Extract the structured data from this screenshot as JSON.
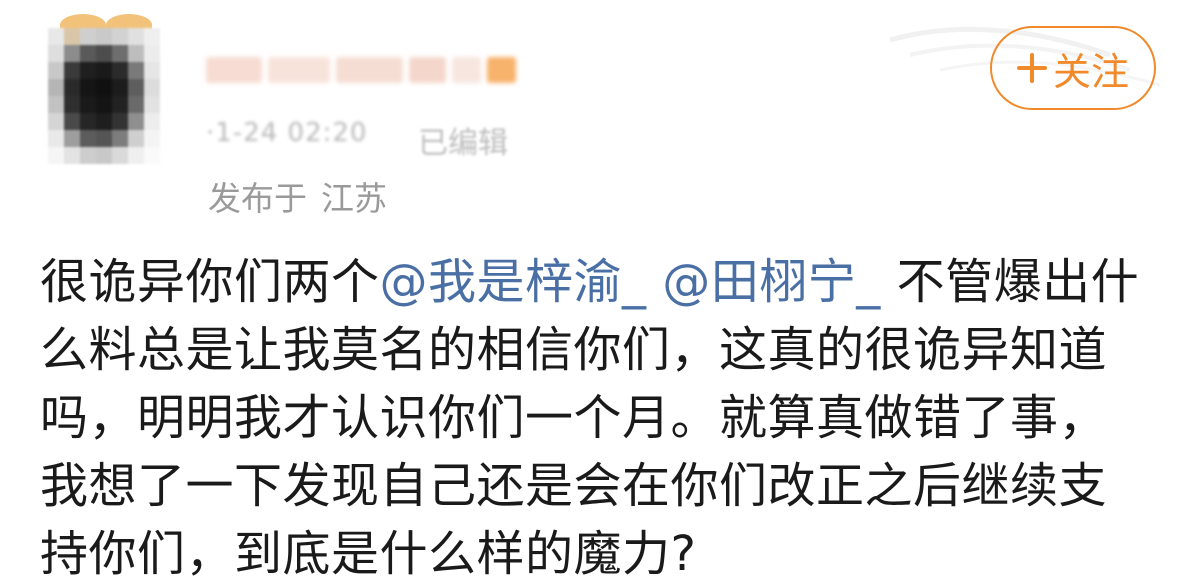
{
  "header": {
    "timestamp": "·1-24 02:20",
    "edited_label": "已编辑",
    "location_prefix": "发布于",
    "location_region": "江苏",
    "follow_button_label": "关注",
    "follow_icon": "plus-icon"
  },
  "post": {
    "line1_prefix": "很诡异你们两个",
    "mention1": "@我是梓渝_",
    "mention2": "@田栩宁_",
    "line1_suffix": "不管爆出什",
    "line2": "么料总是让我莫名的相信你们，这真的很诡异知道",
    "line3": "吗，明明我才认识你们一个月。就算真做错了事，",
    "line4": "我想了一下发现自己还是会在你们改正之后继续支",
    "line5": "持你们，到底是什么样的魔力?"
  },
  "colors": {
    "accent_orange": "#f08a2b",
    "mention_blue": "#4a6fa5",
    "text": "#1a1a1a",
    "meta_gray": "#9a9a9a"
  }
}
